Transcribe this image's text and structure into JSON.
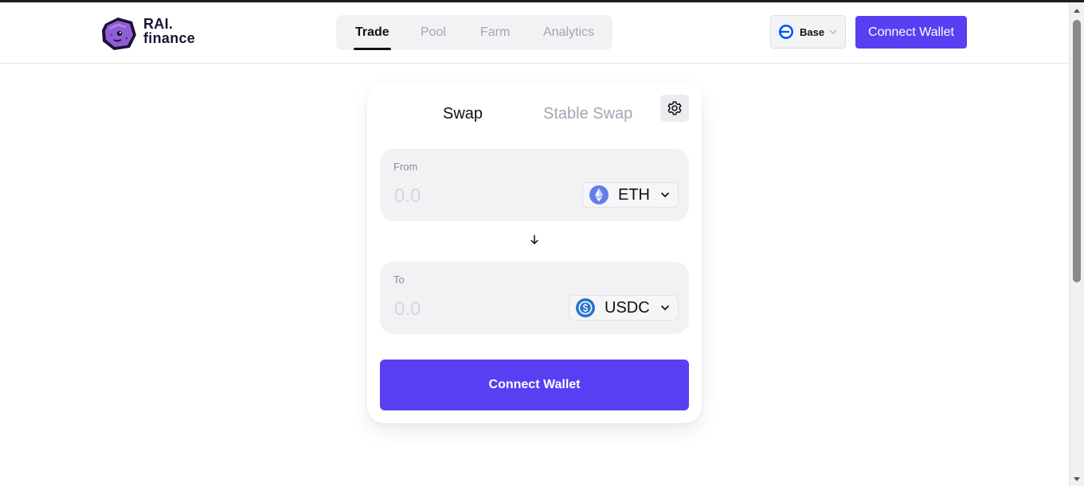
{
  "brand": {
    "name_line1": "RAI.",
    "name_line2": "finance",
    "mascot_color": "#8e5ed8"
  },
  "nav": {
    "items": [
      {
        "label": "Trade",
        "active": true
      },
      {
        "label": "Pool",
        "active": false
      },
      {
        "label": "Farm",
        "active": false
      },
      {
        "label": "Analytics",
        "active": false
      }
    ]
  },
  "network": {
    "label": "Base",
    "icon": "base-network-icon",
    "icon_color": "#0052ff"
  },
  "header_connect": {
    "label": "Connect Wallet"
  },
  "swap": {
    "tabs": [
      {
        "label": "Swap",
        "active": true
      },
      {
        "label": "Stable Swap",
        "active": false
      }
    ],
    "settings_icon": "gear-icon",
    "from": {
      "label": "From",
      "placeholder": "0.0",
      "token": "ETH",
      "token_icon": "ethereum-icon"
    },
    "to": {
      "label": "To",
      "placeholder": "0.0",
      "token": "USDC",
      "token_icon": "usdc-icon"
    },
    "switch_icon": "arrow-down-icon",
    "connect_label": "Connect Wallet"
  },
  "colors": {
    "accent": "#5840f2",
    "panel_bg": "#f2f2f4",
    "muted_text": "#a4a4b4"
  }
}
